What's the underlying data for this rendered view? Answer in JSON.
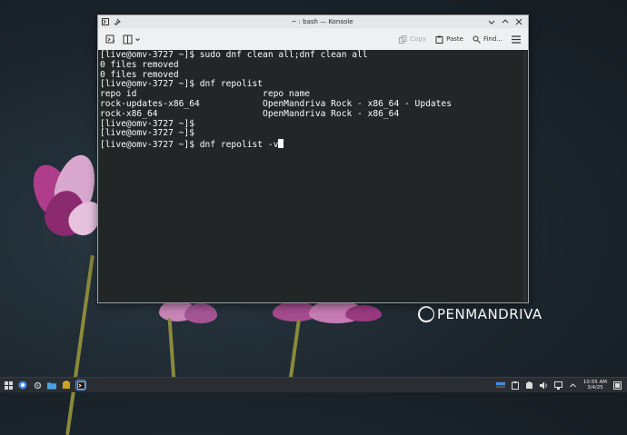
{
  "window": {
    "title": "~ : bash — Konsole",
    "toolbar": {
      "copy_label": "Copy",
      "paste_label": "Paste",
      "find_label": "Find..."
    }
  },
  "terminal": {
    "lines": [
      "[live@omv-3727 ~]$ sudo dnf clean all;dnf clean all",
      "0 files removed",
      "0 files removed",
      "[live@omv-3727 ~]$ dnf repolist",
      "repo id                        repo name",
      "rock-updates-x86_64            OpenMandriva Rock - x86_64 - Updates",
      "rock-x86_64                    OpenMandriva Rock - x86_64",
      "[live@omv-3727 ~]$",
      "[live@omv-3727 ~]$",
      "[live@omv-3727 ~]$ dnf repolist -v"
    ]
  },
  "desktop": {
    "logo_text": "PENMANDRIVA"
  },
  "taskbar": {
    "time": "10:55 AM",
    "date": "3/4/25"
  },
  "colors": {
    "terminal_bg": "#232627",
    "terminal_fg": "#fcfcfc",
    "titlebar_bg": "#e4e6e8",
    "taskbar_bg": "#2a2e32"
  }
}
